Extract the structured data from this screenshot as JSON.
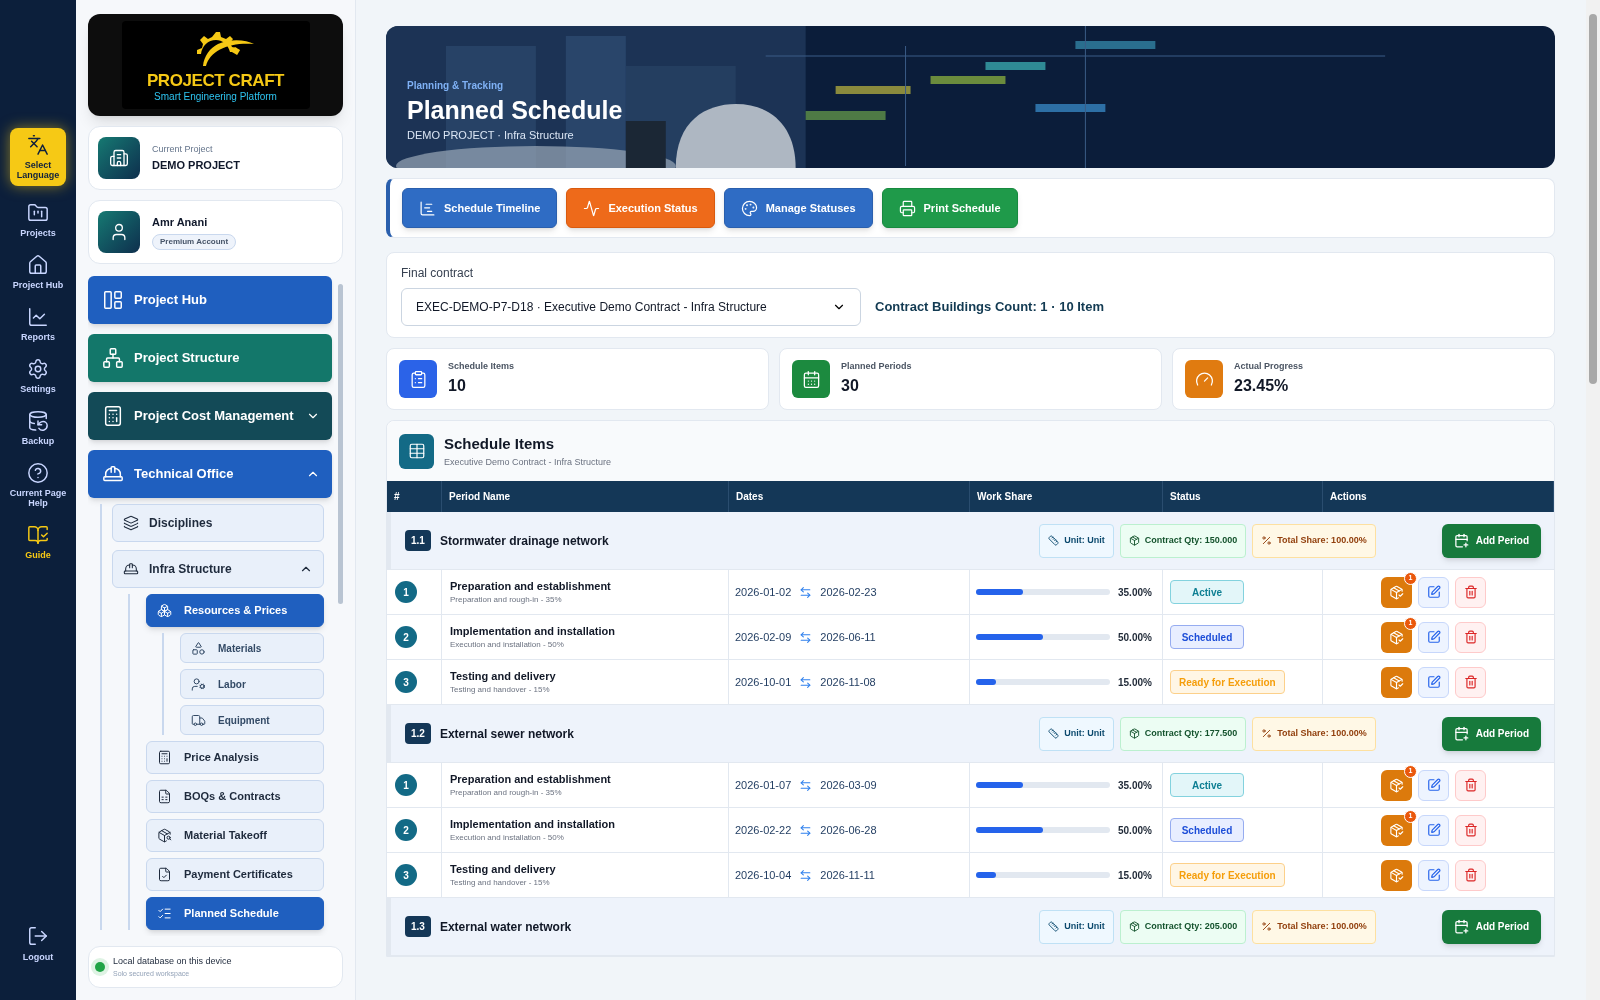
{
  "rail": [
    {
      "label": "Select Language",
      "kind": "language",
      "selected": true
    },
    {
      "label": "Projects",
      "kind": "projects",
      "selected": false
    },
    {
      "label": "Project Hub",
      "kind": "hub",
      "selected": false
    },
    {
      "label": "Reports",
      "kind": "reports",
      "selected": false
    },
    {
      "label": "Settings",
      "kind": "settings",
      "selected": false
    },
    {
      "label": "Backup",
      "kind": "backup",
      "selected": false
    },
    {
      "label": "Current Page Help",
      "kind": "help",
      "selected": false
    },
    {
      "label": "Guide",
      "kind": "guide",
      "selected": false
    }
  ],
  "logout": {
    "label": "Logout"
  },
  "logo": {
    "title": "PROJECT CRAFT",
    "subtitle": "Smart Engineering Platform"
  },
  "project": {
    "label": "Current Project",
    "name": "DEMO PROJECT"
  },
  "user": {
    "name": "Amr Anani",
    "badge": "Premium Account"
  },
  "nav": [
    {
      "label": "Project Hub",
      "kind": "hub",
      "color": "#1f5fbf"
    },
    {
      "label": "Project Structure",
      "kind": "structure",
      "color": "#13776a"
    },
    {
      "label": "Project Cost Management",
      "kind": "cost",
      "color": "#134a57",
      "expanded": false
    },
    {
      "label": "Technical Office",
      "kind": "office",
      "color": "#1f5fbf",
      "expanded": true,
      "children": [
        {
          "label": "Disciplines",
          "kind": "disciplines"
        },
        {
          "label": "Infra Structure",
          "kind": "infra",
          "expanded": true,
          "children": [
            {
              "label": "Resources & Prices",
              "kind": "resources",
              "selected": true,
              "children": [
                {
                  "label": "Materials",
                  "kind": "materials"
                },
                {
                  "label": "Labor",
                  "kind": "labor"
                },
                {
                  "label": "Equipment",
                  "kind": "equipment"
                }
              ]
            },
            {
              "label": "Price Analysis",
              "kind": "analysis",
              "selected": false
            },
            {
              "label": "BOQs & Contracts",
              "kind": "boq",
              "selected": false
            },
            {
              "label": "Material Takeoff",
              "kind": "takeoff",
              "selected": false
            },
            {
              "label": "Payment Certificates",
              "kind": "payment",
              "selected": false
            },
            {
              "label": "Planned Schedule",
              "kind": "schedule",
              "selected": true
            }
          ]
        }
      ]
    }
  ],
  "storage": {
    "online": true,
    "text": "Local database on this device",
    "subtext": "Solo secured workspace"
  },
  "header": {
    "eyebrow": "Planning & Tracking",
    "title": "Planned Schedule",
    "subtitle": "DEMO PROJECT · Infra Structure"
  },
  "toolbar": [
    {
      "label": "Schedule Timeline",
      "kind": "timeline"
    },
    {
      "label": "Execution Status",
      "kind": "execution"
    },
    {
      "label": "Manage Statuses",
      "kind": "statuses"
    },
    {
      "label": "Print Schedule",
      "kind": "print"
    }
  ],
  "contract": {
    "label": "Final contract",
    "value": "EXEC-DEMO-P7-D18 · Executive Demo Contract - Infra Structure",
    "count": "Contract Buildings Count: 1 · 10 Item"
  },
  "stats": [
    {
      "label": "Schedule Items",
      "value": "10",
      "kind": "items"
    },
    {
      "label": "Planned Periods",
      "value": "30",
      "kind": "periods"
    },
    {
      "label": "Actual Progress",
      "value": "23.45%",
      "kind": "progress"
    }
  ],
  "table": {
    "title": "Schedule Items",
    "subtitle": "Executive Demo Contract - Infra Structure",
    "columns": [
      "#",
      "Period Name",
      "Dates",
      "Work Share",
      "Status",
      "Actions"
    ],
    "groups": [
      {
        "code": "1.1",
        "name": "Stormwater drainage network",
        "unit": "Unit: Unit",
        "qty": "Contract Qty: 150.000",
        "share": "Total Share: 100.00%",
        "action": "Add Period",
        "rows": [
          {
            "num": "1",
            "name": "Preparation and establishment",
            "note": "Preparation and rough-in - 35%",
            "start": "2026-01-02",
            "end": "2026-02-23",
            "level": 0.35,
            "share": "35.00%",
            "status": {
              "label": "Active",
              "kind": "active"
            },
            "badge": "1"
          },
          {
            "num": "2",
            "name": "Implementation and installation",
            "note": "Execution and installation - 50%",
            "start": "2026-02-09",
            "end": "2026-06-11",
            "level": 0.5,
            "share": "50.00%",
            "status": {
              "label": "Scheduled",
              "kind": "scheduled"
            },
            "badge": "1"
          },
          {
            "num": "3",
            "name": "Testing and delivery",
            "note": "Testing and handover - 15%",
            "start": "2026-10-01",
            "end": "2026-11-08",
            "level": 0.15,
            "share": "15.00%",
            "status": {
              "label": "Ready for Execution",
              "kind": "ready"
            }
          }
        ]
      },
      {
        "code": "1.2",
        "name": "External sewer network",
        "unit": "Unit: Unit",
        "qty": "Contract Qty: 177.500",
        "share": "Total Share: 100.00%",
        "action": "Add Period",
        "rows": [
          {
            "num": "1",
            "name": "Preparation and establishment",
            "note": "Preparation and rough-in - 35%",
            "start": "2026-01-07",
            "end": "2026-03-09",
            "level": 0.35,
            "share": "35.00%",
            "status": {
              "label": "Active",
              "kind": "active"
            },
            "badge": "1"
          },
          {
            "num": "2",
            "name": "Implementation and installation",
            "note": "Execution and installation - 50%",
            "start": "2026-02-22",
            "end": "2026-06-28",
            "level": 0.5,
            "share": "50.00%",
            "status": {
              "label": "Scheduled",
              "kind": "scheduled"
            },
            "badge": "1"
          },
          {
            "num": "3",
            "name": "Testing and delivery",
            "note": "Testing and handover - 15%",
            "start": "2026-10-04",
            "end": "2026-11-11",
            "level": 0.15,
            "share": "15.00%",
            "status": {
              "label": "Ready for Execution",
              "kind": "ready"
            }
          }
        ]
      },
      {
        "code": "1.3",
        "name": "External water network",
        "unit": "Unit: Unit",
        "qty": "Contract Qty: 205.000",
        "share": "Total Share: 100.00%",
        "action": "Add Period"
      }
    ]
  }
}
